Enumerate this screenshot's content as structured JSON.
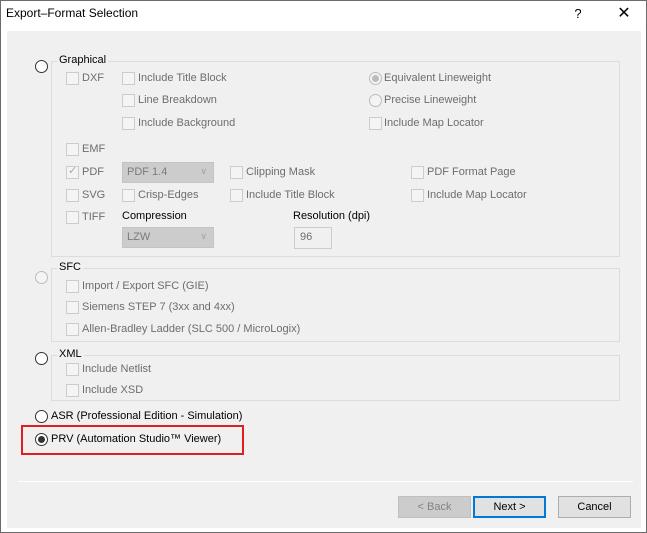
{
  "window": {
    "title": "Export–Format Selection",
    "help_label": "?",
    "close_label": "✕"
  },
  "graphical": {
    "label": "Graphical",
    "selected": false,
    "dxf": {
      "label": "DXF",
      "checked": false,
      "options": [
        {
          "label": "Include Title Block",
          "checked": false
        },
        {
          "label": "Line Breakdown",
          "checked": false
        },
        {
          "label": "Include Background",
          "checked": false
        }
      ],
      "lineweight": [
        {
          "label": "Equivalent Lineweight",
          "selected": true
        },
        {
          "label": "Precise Lineweight",
          "selected": false
        }
      ],
      "map_locator": {
        "label": "Include Map Locator",
        "checked": false
      }
    },
    "emf": {
      "label": "EMF",
      "checked": false
    },
    "pdf": {
      "label": "PDF",
      "checked": true,
      "version": "PDF 1.4",
      "clipping_mask": {
        "label": "Clipping Mask",
        "checked": false
      },
      "format_page": {
        "label": "PDF Format Page",
        "checked": false
      }
    },
    "svg": {
      "label": "SVG",
      "checked": false,
      "crisp_edges": {
        "label": "Crisp-Edges",
        "checked": false
      },
      "title_block": {
        "label": "Include Title Block",
        "checked": false
      },
      "map_locator": {
        "label": "Include Map Locator",
        "checked": false
      }
    },
    "tiff": {
      "label": "TIFF",
      "checked": false,
      "compression_label": "Compression",
      "compression_value": "LZW",
      "resolution_label": "Resolution (dpi)",
      "resolution_value": "96"
    }
  },
  "sfc": {
    "label": "SFC",
    "selected": false,
    "options": [
      {
        "label": "Import / Export SFC (GIE)",
        "checked": false
      },
      {
        "label": "Siemens STEP 7 (3xx and 4xx)",
        "checked": false
      },
      {
        "label": "Allen-Bradley Ladder (SLC 500 / MicroLogix)",
        "checked": false
      }
    ]
  },
  "xml": {
    "label": "XML",
    "selected": false,
    "options": [
      {
        "label": "Include Netlist",
        "checked": false
      },
      {
        "label": "Include XSD",
        "checked": false
      }
    ]
  },
  "asr": {
    "label": "ASR (Professional Edition - Simulation)",
    "selected": false
  },
  "prv": {
    "label": "PRV (Automation Studio™  Viewer)",
    "selected": true
  },
  "buttons": {
    "back": "< Back",
    "next": "Next >",
    "cancel": "Cancel"
  },
  "colors": {
    "highlight": "#e02020",
    "default_button_border": "#0078d7"
  }
}
